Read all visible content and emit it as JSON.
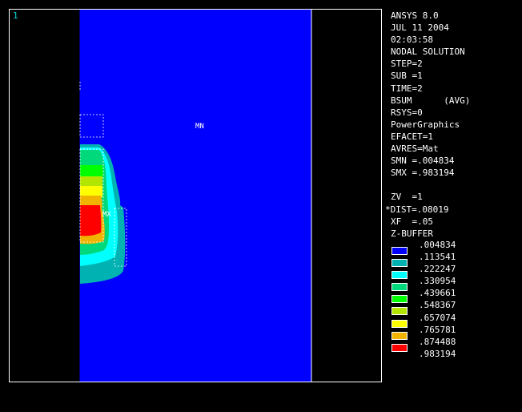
{
  "viewport": {
    "window_number": "1",
    "label_min": "MN",
    "label_max": "MX",
    "background_color": "#0000ff"
  },
  "info": {
    "product": "ANSYS 8.0",
    "date": "JUL 11 2004",
    "time": "02:03:58",
    "solution": "NODAL SOLUTION",
    "step": "STEP=2",
    "sub": "SUB =1",
    "time_value": "TIME=2",
    "item": "BSUM      (AVG)",
    "rsys": "RSYS=0",
    "graphics": "PowerGraphics",
    "efacet": "EFACET=1",
    "avres": "AVRES=Mat",
    "smn": "SMN =.004834",
    "smx": "SMX =.983194",
    "zv": "ZV  =1",
    "dist": "*DIST=.08019",
    "xf": "XF  =.05",
    "zbuffer": "Z-BUFFER"
  },
  "legend": {
    "items": [
      {
        "value": ".004834",
        "color": "#0000ff"
      },
      {
        "value": ".113541",
        "color": "#00b2b2"
      },
      {
        "value": ".222247",
        "color": "#00ffff"
      },
      {
        "value": ".330954",
        "color": "#00d87c"
      },
      {
        "value": ".439661",
        "color": "#00ff00"
      },
      {
        "value": ".548367",
        "color": "#b2e600"
      },
      {
        "value": ".657074",
        "color": "#ffff00"
      },
      {
        "value": ".765781",
        "color": "#f0b400"
      },
      {
        "value": ".874488",
        "color": "#ff0000"
      },
      {
        "value": ".983194",
        "color": ""
      }
    ]
  }
}
